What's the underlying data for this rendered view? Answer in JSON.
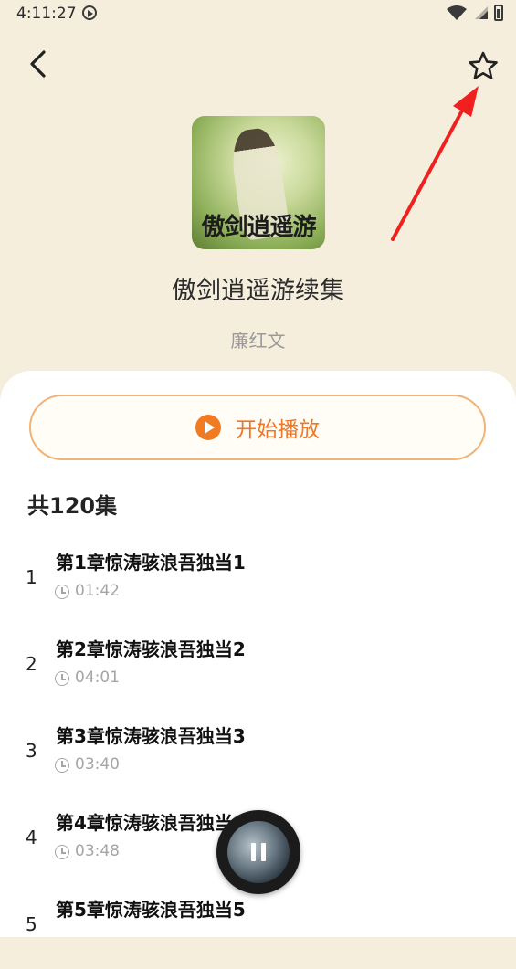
{
  "status_bar": {
    "time": "4:11:27"
  },
  "book": {
    "cover_text": "傲剑逍遥游",
    "title": "傲剑逍遥游续集",
    "author": "廉红文"
  },
  "play_button": {
    "label": "开始播放"
  },
  "episode_count": "共120集",
  "episodes": [
    {
      "num": "1",
      "title": "第1章惊涛骇浪吾独当1",
      "duration": "01:42"
    },
    {
      "num": "2",
      "title": "第2章惊涛骇浪吾独当2",
      "duration": "04:01"
    },
    {
      "num": "3",
      "title": "第3章惊涛骇浪吾独当3",
      "duration": "03:40"
    },
    {
      "num": "4",
      "title": "第4章惊涛骇浪吾独当4",
      "duration": "03:48"
    },
    {
      "num": "5",
      "title": "第5章惊涛骇浪吾独当5",
      "duration": ""
    }
  ],
  "colors": {
    "accent": "#ee7625",
    "header_bg": "#f5eedc",
    "annotation": "#f02020"
  },
  "icons": {
    "back": "chevron-left-icon",
    "favorite": "star-outline-icon",
    "play": "play-circle-icon",
    "clock": "clock-icon",
    "pause": "pause-icon"
  }
}
